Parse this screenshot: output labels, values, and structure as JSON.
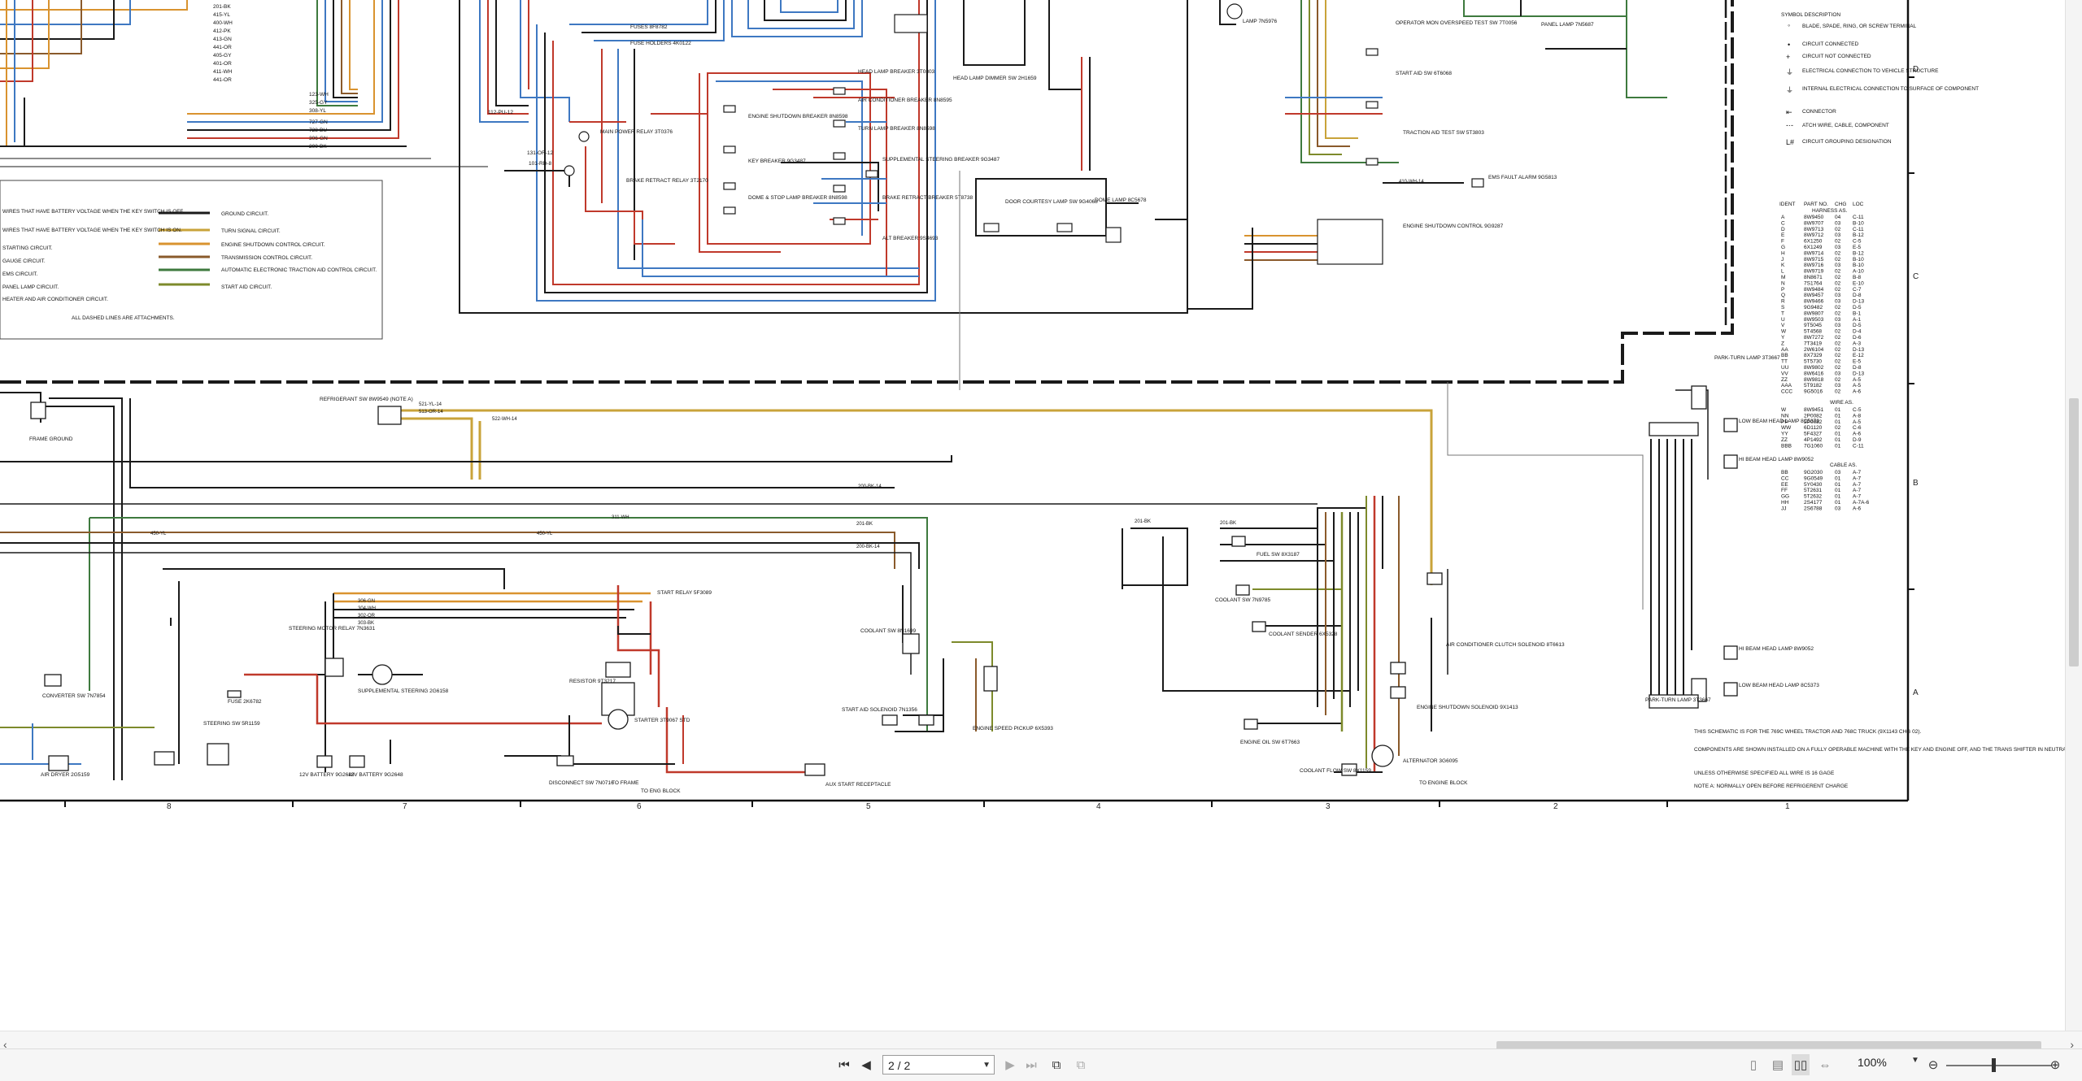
{
  "legend": {
    "entries": [
      "WIRES THAT HAVE BATTERY VOLTAGE WHEN THE KEY SWITCH IS OFF.",
      "WIRES THAT HAVE BATTERY VOLTAGE WHEN THE KEY SWITCH IS ON.",
      "STARTING CIRCUIT.",
      "GAUGE CIRCUIT.",
      "EMS CIRCUIT.",
      "PANEL LAMP CIRCUIT.",
      "HEATER AND AIR CONDITIONER CIRCUIT.",
      "GROUND CIRCUIT.",
      "TURN SIGNAL CIRCUIT.",
      "ENGINE SHUTDOWN CONTROL CIRCUIT.",
      "TRANSMISSION CONTROL CIRCUIT.",
      "AUTOMATIC ELECTRONIC TRACTION AID CONTROL CIRCUIT.",
      "START AID CIRCUIT."
    ],
    "dashed_note": "ALL DASHED LINES ARE ATTACHMENTS."
  },
  "symbols": {
    "title": "SYMBOL   DESCRIPTION",
    "items": [
      "BLADE, SPADE, RING, OR SCREW TERMINAL",
      "CIRCUIT CONNECTED",
      "CIRCUIT NOT CONNECTED",
      "ELECTRICAL CONNECTION TO VEHICLE STRUCTURE",
      "INTERNAL ELECTRICAL CONNECTION TO SURFACE OF COMPONENT",
      "CONNECTOR",
      "ATCH WIRE, CABLE, COMPONENT",
      "CIRCUIT GROUPING DESIGNATION"
    ]
  },
  "harness_table": {
    "headers": [
      "IDENT",
      "PART NO.",
      "CHG",
      "LOC"
    ],
    "harness_title": "HARNESS AS.",
    "rows": [
      [
        "A",
        "8W9450",
        "04",
        "C-11"
      ],
      [
        "C",
        "8W9707",
        "03",
        "B-10"
      ],
      [
        "D",
        "8W9713",
        "02",
        "C-11"
      ],
      [
        "E",
        "8W9712",
        "03",
        "B-12"
      ],
      [
        "F",
        "6X1250",
        "02",
        "C-5"
      ],
      [
        "G",
        "6X1249",
        "03",
        "E-5"
      ],
      [
        "H",
        "8W9714",
        "02",
        "B-12"
      ],
      [
        "J",
        "8W9715",
        "02",
        "B-10"
      ],
      [
        "K",
        "8W9716",
        "03",
        "B-10"
      ],
      [
        "L",
        "8W9719",
        "02",
        "A-10"
      ],
      [
        "M",
        "8N8671",
        "02",
        "B-8"
      ],
      [
        "N",
        "7S1764",
        "02",
        "E-10"
      ],
      [
        "P",
        "8W9484",
        "02",
        "C-7"
      ],
      [
        "Q",
        "8W9457",
        "03",
        "D-8"
      ],
      [
        "R",
        "8W9466",
        "03",
        "D-13"
      ],
      [
        "S",
        "9G9482",
        "02",
        "D-5"
      ],
      [
        "T",
        "8W9807",
        "02",
        "B-1"
      ],
      [
        "U",
        "8W9503",
        "03",
        "A-1"
      ],
      [
        "V",
        "9T5045",
        "03",
        "D-5"
      ],
      [
        "W",
        "5T4568",
        "02",
        "D-4"
      ],
      [
        "Y",
        "8W7272",
        "02",
        "D-6"
      ],
      [
        "Z",
        "7T3419",
        "02",
        "A-3"
      ],
      [
        "AA",
        "2W6104",
        "02",
        "D-13"
      ],
      [
        "BB",
        "8X7329",
        "02",
        "E-12"
      ],
      [
        "TT",
        "5T5730",
        "02",
        "E-5"
      ],
      [
        "UU",
        "8W9802",
        "02",
        "D-8"
      ],
      [
        "VV",
        "8W6416",
        "03",
        "D-13"
      ],
      [
        "ZZ",
        "8W9818",
        "02",
        "A-5"
      ],
      [
        "AAA",
        "5T9182",
        "03",
        "A-5"
      ],
      [
        "CCC",
        "9G5016",
        "02",
        "A-6"
      ]
    ],
    "wire_title": "WIRE AS.",
    "wire_rows": [
      [
        "W",
        "8W9451",
        "01",
        "C-5"
      ],
      [
        "NN",
        "2P0082",
        "01",
        "A-8"
      ],
      [
        "PP",
        "2P0082",
        "01",
        "A-5"
      ],
      [
        "WW",
        "6D1120",
        "02",
        "C-6"
      ],
      [
        "YY",
        "5F4327",
        "01",
        "A-6"
      ],
      [
        "ZZ",
        "4P1492",
        "01",
        "D-9"
      ],
      [
        "BBB",
        "7G1060",
        "01",
        "C-11"
      ]
    ],
    "cable_title": "CABLE AS.",
    "cable_rows": [
      [
        "BB",
        "9G2030",
        "03",
        "A-7"
      ],
      [
        "CC",
        "9G0549",
        "01",
        "A-7"
      ],
      [
        "EE",
        "5Y0430",
        "01",
        "A-7"
      ],
      [
        "FF",
        "5T2631",
        "01",
        "A-7"
      ],
      [
        "GG",
        "5T2632",
        "01",
        "A-7"
      ],
      [
        "HH",
        "2S4177",
        "01",
        "A-7A-6"
      ],
      [
        "JJ",
        "2S6788",
        "03",
        "A-6"
      ]
    ]
  },
  "components": {
    "main_power_relay": "MAIN POWER RELAY 3T0376",
    "fuses": "FUSES 8F8782",
    "fuse_holders": "FUSE HOLDERS 4K0122",
    "head_lamp_breaker": "HEAD LAMP BREAKER 3T0803",
    "ac_breaker": "AIR CONDITIONER BREAKER 8N8595",
    "engine_shutdown_breaker": "ENGINE SHUTDOWN BREAKER 8N8598",
    "turn_lamp_breaker": "TURN LAMP BREAKER 8N8598",
    "supplemental_steering_breaker": "SUPPLEMENTAL STEERING BREAKER 9G3487",
    "key_breaker": "KEY BREAKER 9G3487",
    "dome_stop_breaker": "DOME & STOP LAMP BREAKER 8N8598",
    "brake_retract_breaker": "BRAKE RETRACT BREAKER 5T8738",
    "alt_breaker": "ALT BREAKER 9S4693",
    "brake_retract_relay": "BRAKE RETRACT RELAY 3T2170",
    "head_lamp_dimmer": "HEAD LAMP DIMMER SW 2H1659",
    "door_courtesy": "DOOR COURTESY LAMP SW 9G4068",
    "dome_lamp": "DOME LAMP 8C5678",
    "lamp": "LAMP 7N5976",
    "operator_mon": "OPERATOR MON OVERSPEED TEST SW 7T0056",
    "start_aid_sw": "START AID SW 6T6068",
    "traction_aid": "TRACTION AID TEST SW 5T3803",
    "ems_fault_alarm": "EMS FAULT ALARM 9G5813",
    "engine_shutdown_control": "ENGINE SHUTDOWN CONTROL 9G9287",
    "panel_lamp": "PANEL LAMP 7N5687",
    "refrigerant_sw": "REFRIGERANT SW 8W9549 (NOTE A)",
    "frame_ground": "FRAME GROUND",
    "park_turn_lamp_top": "PARK-TURN LAMP 3T3667",
    "low_beam_top": "LOW BEAM HEAD LAMP 8C5373",
    "hi_beam_top": "HI BEAM HEAD LAMP 8W9052",
    "hi_beam_bottom": "HI BEAM HEAD LAMP 8W9052",
    "low_beam_bottom": "LOW BEAM HEAD LAMP 8C5373",
    "park_turn_lamp_bottom": "PARK-TURN LAMP 3T3667",
    "start_relay": "START RELAY 5F3089",
    "steering_motor_relay": "STEERING MOTOR RELAY 7N3631",
    "supplemental_steering": "SUPPLEMENTAL STEERING 2G6158",
    "resistor": "RESISTOR 9T3217",
    "starter": "STARTER 3T9067 STD",
    "coolant_sw_left": "COOLANT SW 8N1699",
    "start_aid_solenoid": "START AID SOLENOID 7N1356",
    "engine_speed_pickup": "ENGINE SPEED PICKUP 6X5393",
    "aux_start_receptacle": "AUX START RECEPTACLE",
    "disconnect_sw": "DISCONNECT SW 7N0716",
    "to_frame": "TO FRAME",
    "to_eng_block": "TO ENG BLOCK",
    "battery_1": "12V BATTERY 9G2648",
    "battery_2": "12V BATTERY 9G2648",
    "steering_sw": "STEERING SW 5R1159",
    "air_dryer": "AIR DRYER 2G5159",
    "converter_sw": "CONVERTER SW 7N7854",
    "fuse_2k": "FUSE 2K6782",
    "fuel_sw": "FUEL SW 8X3187",
    "coolant_sw_right": "COOLANT SW 7N9785",
    "coolant_sender": "COOLANT SENDER 6X5328",
    "ac_clutch": "AIR CONDITIONER CLUTCH SOLENOID 8T6613",
    "engine_shutdown_solenoid": "ENGINE SHUTDOWN SOLENOID 9X1413",
    "engine_oil_sw": "ENGINE OIL SW 6T7663",
    "coolant_flow_sw": "COOLANT FLOW SW 8X1159",
    "alternator": "ALTERNATOR 3G6095",
    "to_engine_block": "TO ENGINE BLOCK"
  },
  "notes": [
    "THIS SCHEMATIC IS FOR THE 769C WHEEL TRACTOR AND 768C TRUCK (9X1143 CHG 02).",
    "COMPONENTS ARE SHOWN INSTALLED ON A FULLY OPERABLE MACHINE WITH THE KEY AND ENGINE OFF, AND THE TRANS SHIFTER IN NEUTRAL.",
    "UNLESS OTHERWISE SPECIFIED ALL WIRE IS 16 GAGE",
    "NOTE A: NORMALLY OPEN BEFORE REFRIGERENT CHARGE"
  ],
  "grid": {
    "columns": [
      "8",
      "7",
      "6",
      "5",
      "4",
      "3",
      "2",
      "1"
    ],
    "rows": [
      "D",
      "C",
      "B",
      "A"
    ]
  },
  "wire_labels": {
    "w200bk": "200-BK-14",
    "w450yl": "450-YL",
    "w311wh": "311-WH",
    "w201bk": "201-BK",
    "w522wh": "522-WH-14",
    "w521yl": "521-YL-14",
    "w513or": "513-OR-14",
    "w101rd": "101-RD-8",
    "w131or": "131-OR-12",
    "w112pu": "112-PU-12",
    "w410wh": "410-WH-14",
    "w306gn": "306-GN",
    "w304wh": "304-WH",
    "w302or": "302-OR",
    "w303bk": "303-BK"
  },
  "viewer": {
    "page_value": "2 / 2",
    "zoom": "100%"
  },
  "colors": {
    "red": "#c0392b",
    "blue": "#3e78c2",
    "orange": "#d9932f",
    "gold": "#c9a33a",
    "green": "#3e7a3e",
    "olive": "#7d8a2b",
    "brown": "#8a5a2b",
    "black": "#1a1a1a"
  }
}
